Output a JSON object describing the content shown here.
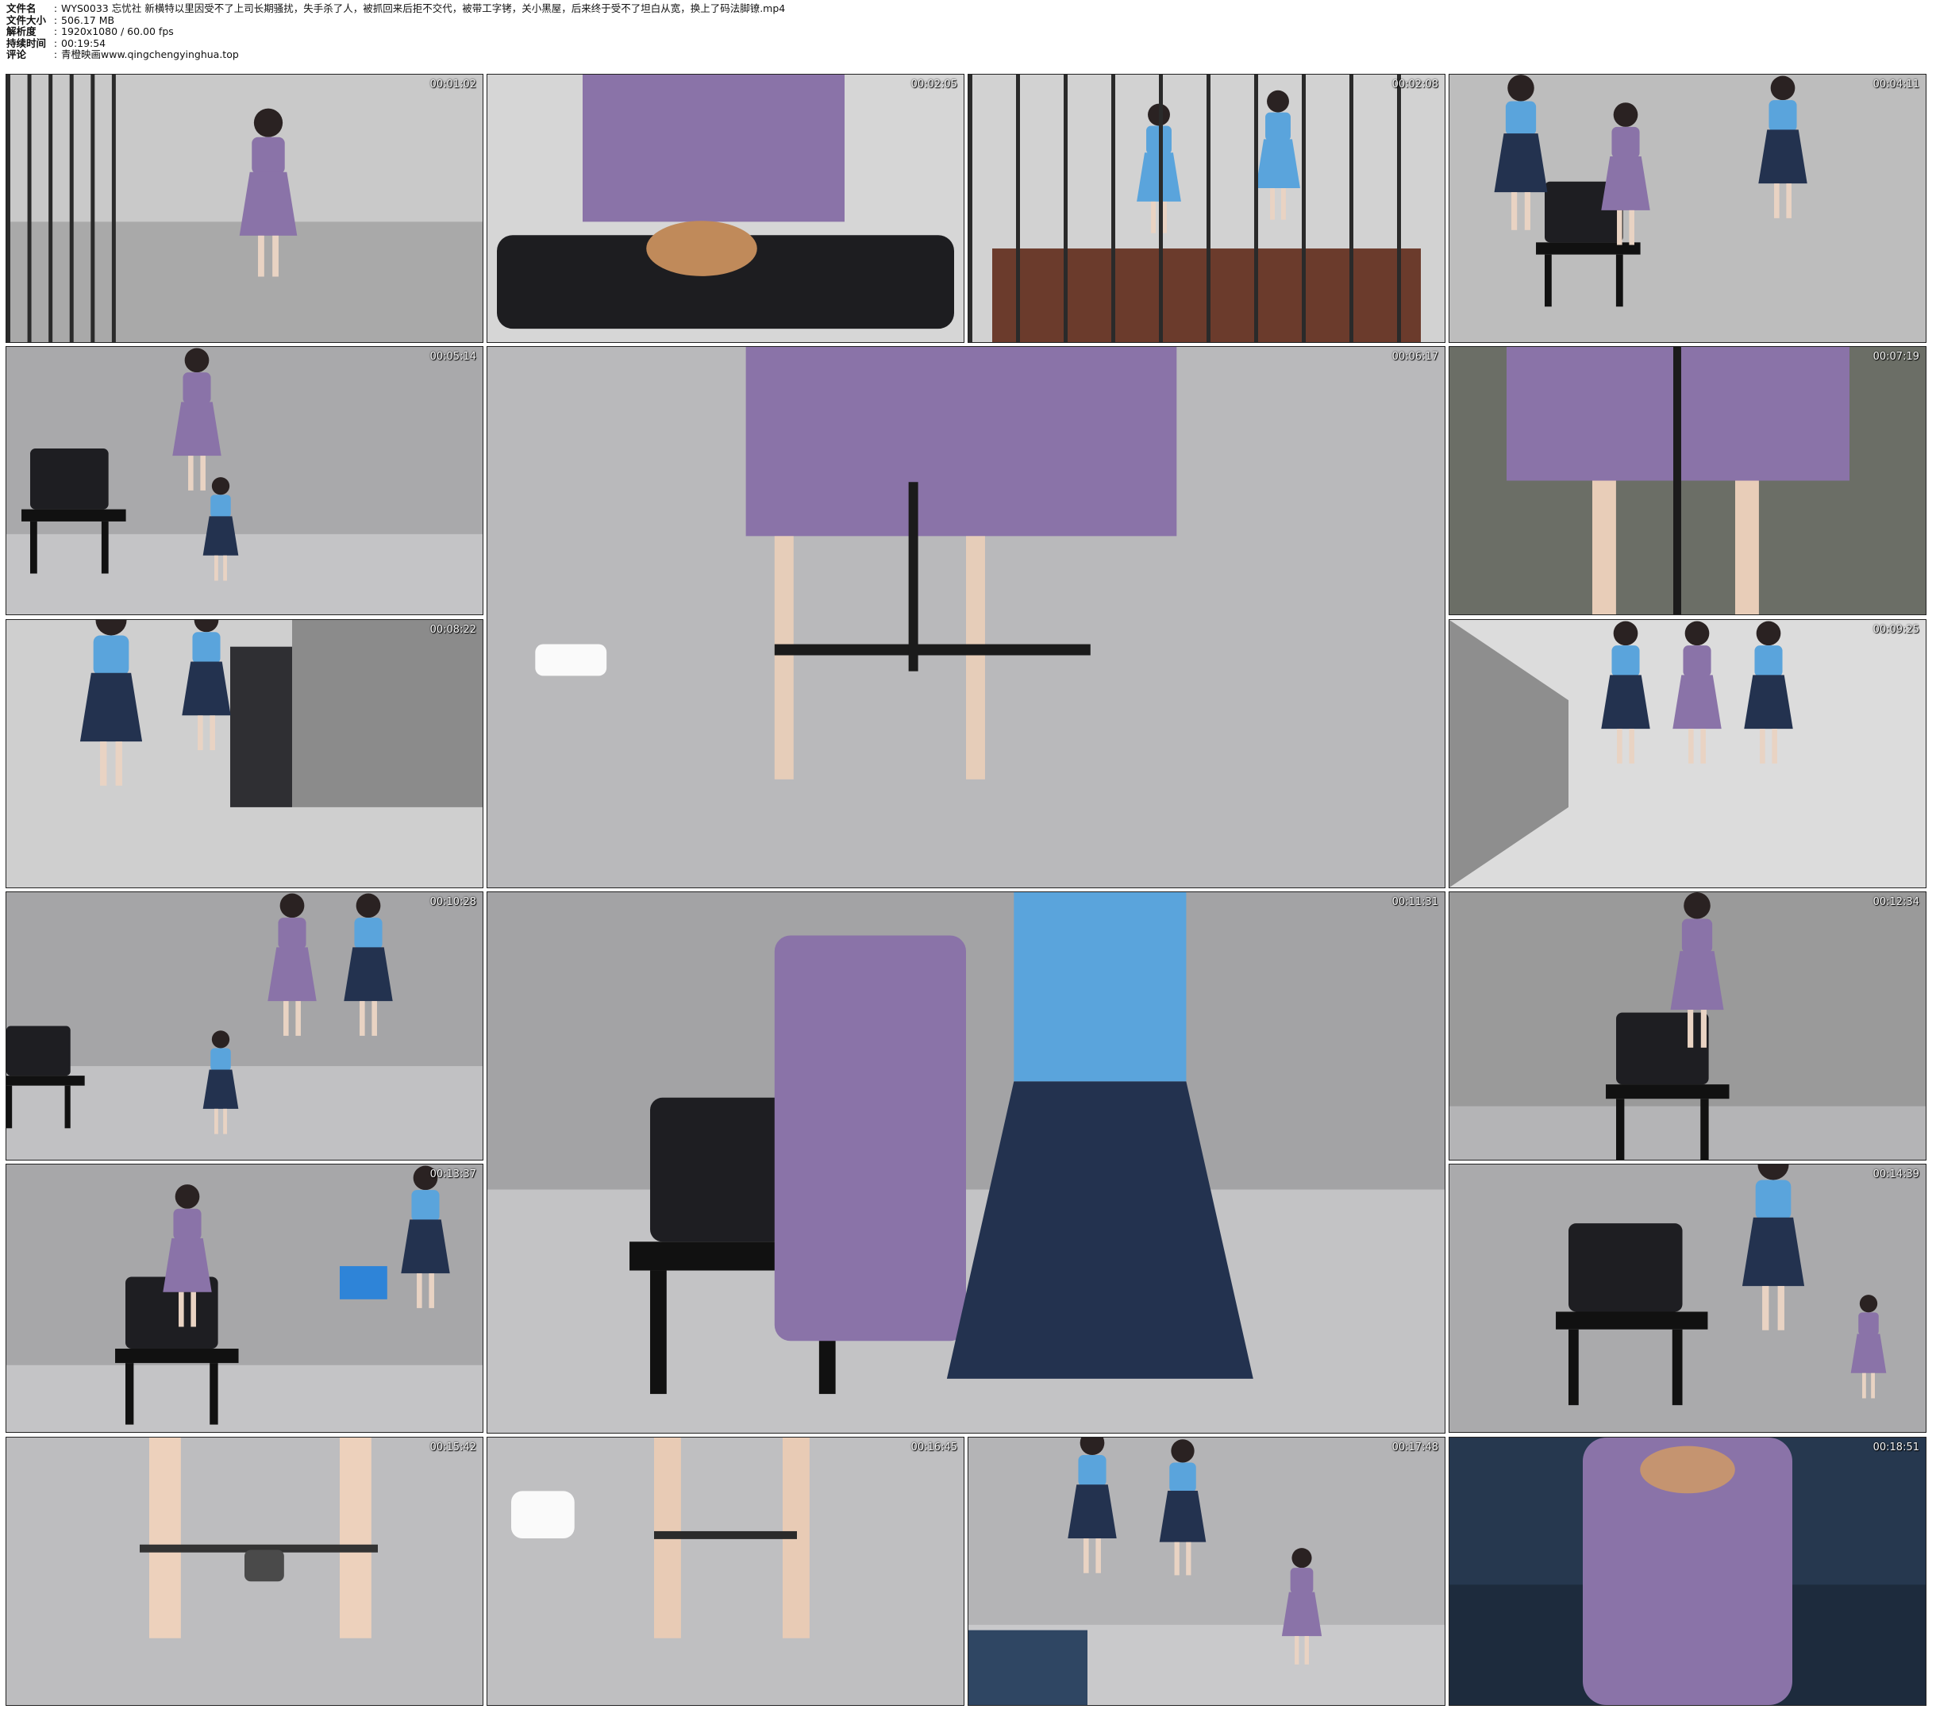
{
  "header": {
    "rows": [
      {
        "key": "文件名",
        "value": "WYS0033 忘忧社 新横特以里因受不了上司长期骚扰，失手杀了人，被抓回来后拒不交代，被带工字铐，关小黑屋，后来终于受不了坦白从宽，换上了码法脚镣.mp4"
      },
      {
        "key": "文件大小",
        "value": "506.17 MB"
      },
      {
        "key": "解析度",
        "value": "1920x1080 / 60.00 fps"
      },
      {
        "key": "持续时间",
        "value": "00:19:54"
      },
      {
        "key": "评论",
        "value": "青橙映画www.qingchengyinghua.top"
      }
    ],
    "separator": ":"
  },
  "thumbnails": [
    {
      "time": "00:01:02",
      "scene": "corridor-crouch"
    },
    {
      "time": "00:02:05",
      "scene": "handcuffs-desk"
    },
    {
      "time": "00:02:08",
      "scene": "officers-behind-bars"
    },
    {
      "time": "00:04:11",
      "scene": "chair-officers"
    },
    {
      "time": "00:05:14",
      "scene": "room-chair"
    },
    {
      "time": "00:06:17",
      "scene": "ankle-stocks-large"
    },
    {
      "time": "00:07:19",
      "scene": "dress-legs"
    },
    {
      "time": "00:08:22",
      "scene": "officers-walk"
    },
    {
      "time": "00:09:25",
      "scene": "corridor-three"
    },
    {
      "time": "00:10:28",
      "scene": "room-kneel"
    },
    {
      "time": "00:11:31",
      "scene": "chair-cuffing-large"
    },
    {
      "time": "00:12:34",
      "scene": "seated-front"
    },
    {
      "time": "00:13:37",
      "scene": "seated-folder"
    },
    {
      "time": "00:14:39",
      "scene": "chair-crouch"
    },
    {
      "time": "00:15:42",
      "scene": "bare-feet-shackles"
    },
    {
      "time": "00:16:45",
      "scene": "shackles-sneaker"
    },
    {
      "time": "00:17:48",
      "scene": "officers-corner"
    },
    {
      "time": "00:18:51",
      "scene": "seated-bed"
    }
  ]
}
